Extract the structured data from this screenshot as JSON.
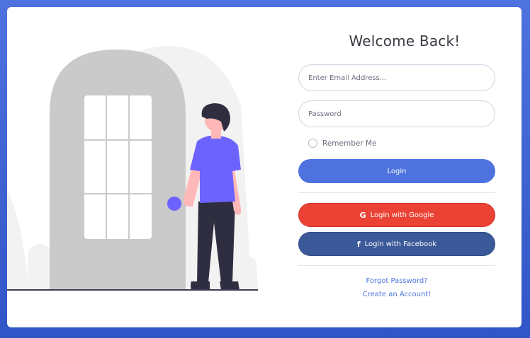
{
  "form": {
    "title": "Welcome Back!",
    "email_placeholder": "Enter Email Address...",
    "password_placeholder": "Password",
    "remember_label": "Remember Me",
    "login_label": "Login",
    "google_label": "Login with Google",
    "facebook_label": "Login with Facebook",
    "forgot_label": "Forgot Password?",
    "create_label": "Create an Account!"
  },
  "icons": {
    "google": "google-icon",
    "facebook": "facebook-icon"
  },
  "colors": {
    "primary": "#4e73df",
    "google": "#ea4335",
    "facebook": "#3b5998",
    "person_shirt": "#6c63ff"
  }
}
